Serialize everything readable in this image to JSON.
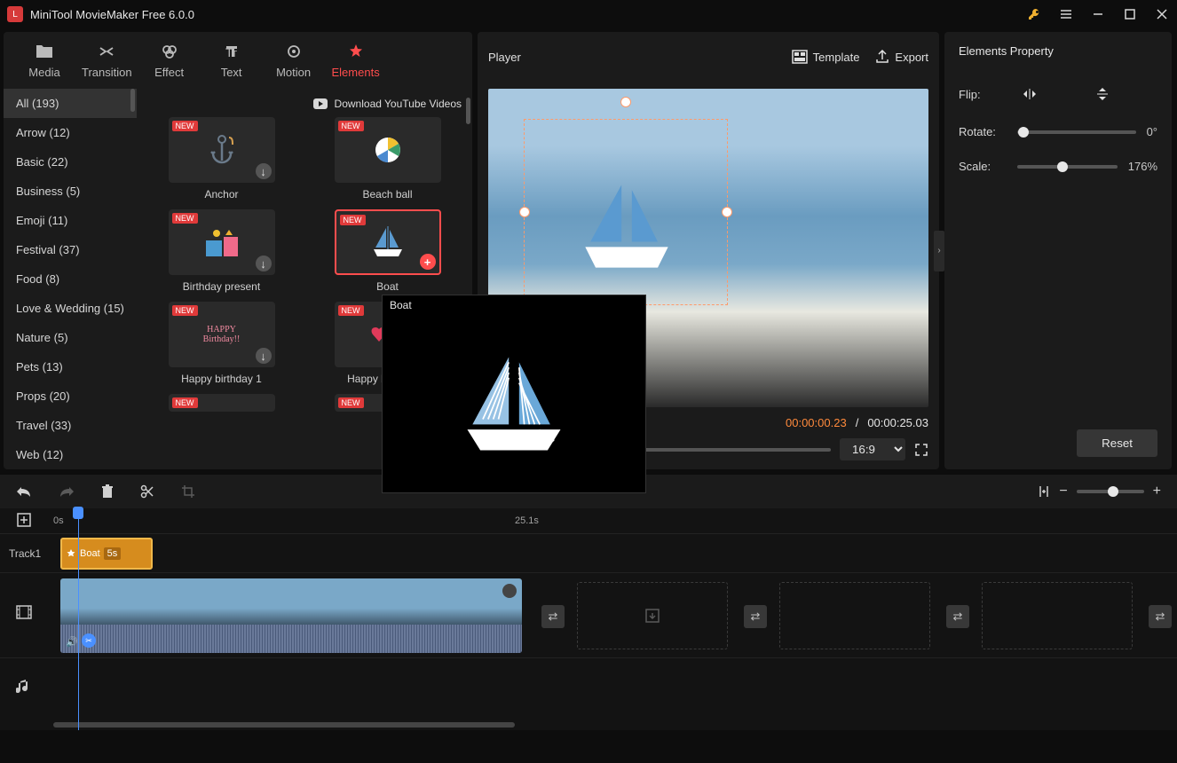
{
  "titlebar": {
    "app": "MiniTool MovieMaker Free 6.0.0"
  },
  "tabs": [
    {
      "label": "Media",
      "icon": "folder-icon"
    },
    {
      "label": "Transition",
      "icon": "transition-icon"
    },
    {
      "label": "Effect",
      "icon": "effect-icon"
    },
    {
      "label": "Text",
      "icon": "text-icon"
    },
    {
      "label": "Motion",
      "icon": "motion-icon"
    },
    {
      "label": "Elements",
      "icon": "elements-icon",
      "active": true
    }
  ],
  "download_link": "Download YouTube Videos",
  "categories": [
    {
      "label": "All (193)",
      "active": true
    },
    {
      "label": "Arrow (12)"
    },
    {
      "label": "Basic (22)"
    },
    {
      "label": "Business (5)"
    },
    {
      "label": "Emoji (11)"
    },
    {
      "label": "Festival (37)"
    },
    {
      "label": "Food (8)"
    },
    {
      "label": "Love & Wedding (15)"
    },
    {
      "label": "Nature (5)"
    },
    {
      "label": "Pets (13)"
    },
    {
      "label": "Props (20)"
    },
    {
      "label": "Travel (33)"
    },
    {
      "label": "Web (12)"
    }
  ],
  "elements": [
    {
      "label": "Anchor",
      "new": true,
      "downloadable": true
    },
    {
      "label": "Beach ball",
      "new": true
    },
    {
      "label": "Birthday present",
      "new": true,
      "downloadable": true
    },
    {
      "label": "Boat",
      "new": true,
      "selected": true,
      "add": true
    },
    {
      "label": "Happy birthday 1",
      "new": true,
      "downloadable": true
    },
    {
      "label": "Happy birthday 2",
      "new": true,
      "downloadable": true
    }
  ],
  "tooltip": {
    "label": "Boat"
  },
  "player": {
    "title": "Player",
    "template": "Template",
    "export": "Export",
    "time_cur": "00:00:00.23",
    "time_total": "00:00:25.03",
    "aspect": "16:9"
  },
  "props": {
    "title": "Elements Property",
    "flip": "Flip:",
    "rotate": "Rotate:",
    "rotate_val": "0°",
    "scale": "Scale:",
    "scale_val": "176%",
    "reset": "Reset"
  },
  "timeline": {
    "start": "0s",
    "mark": "25.1s",
    "track1": "Track1",
    "clip_name": "Boat",
    "clip_dur": "5s"
  }
}
